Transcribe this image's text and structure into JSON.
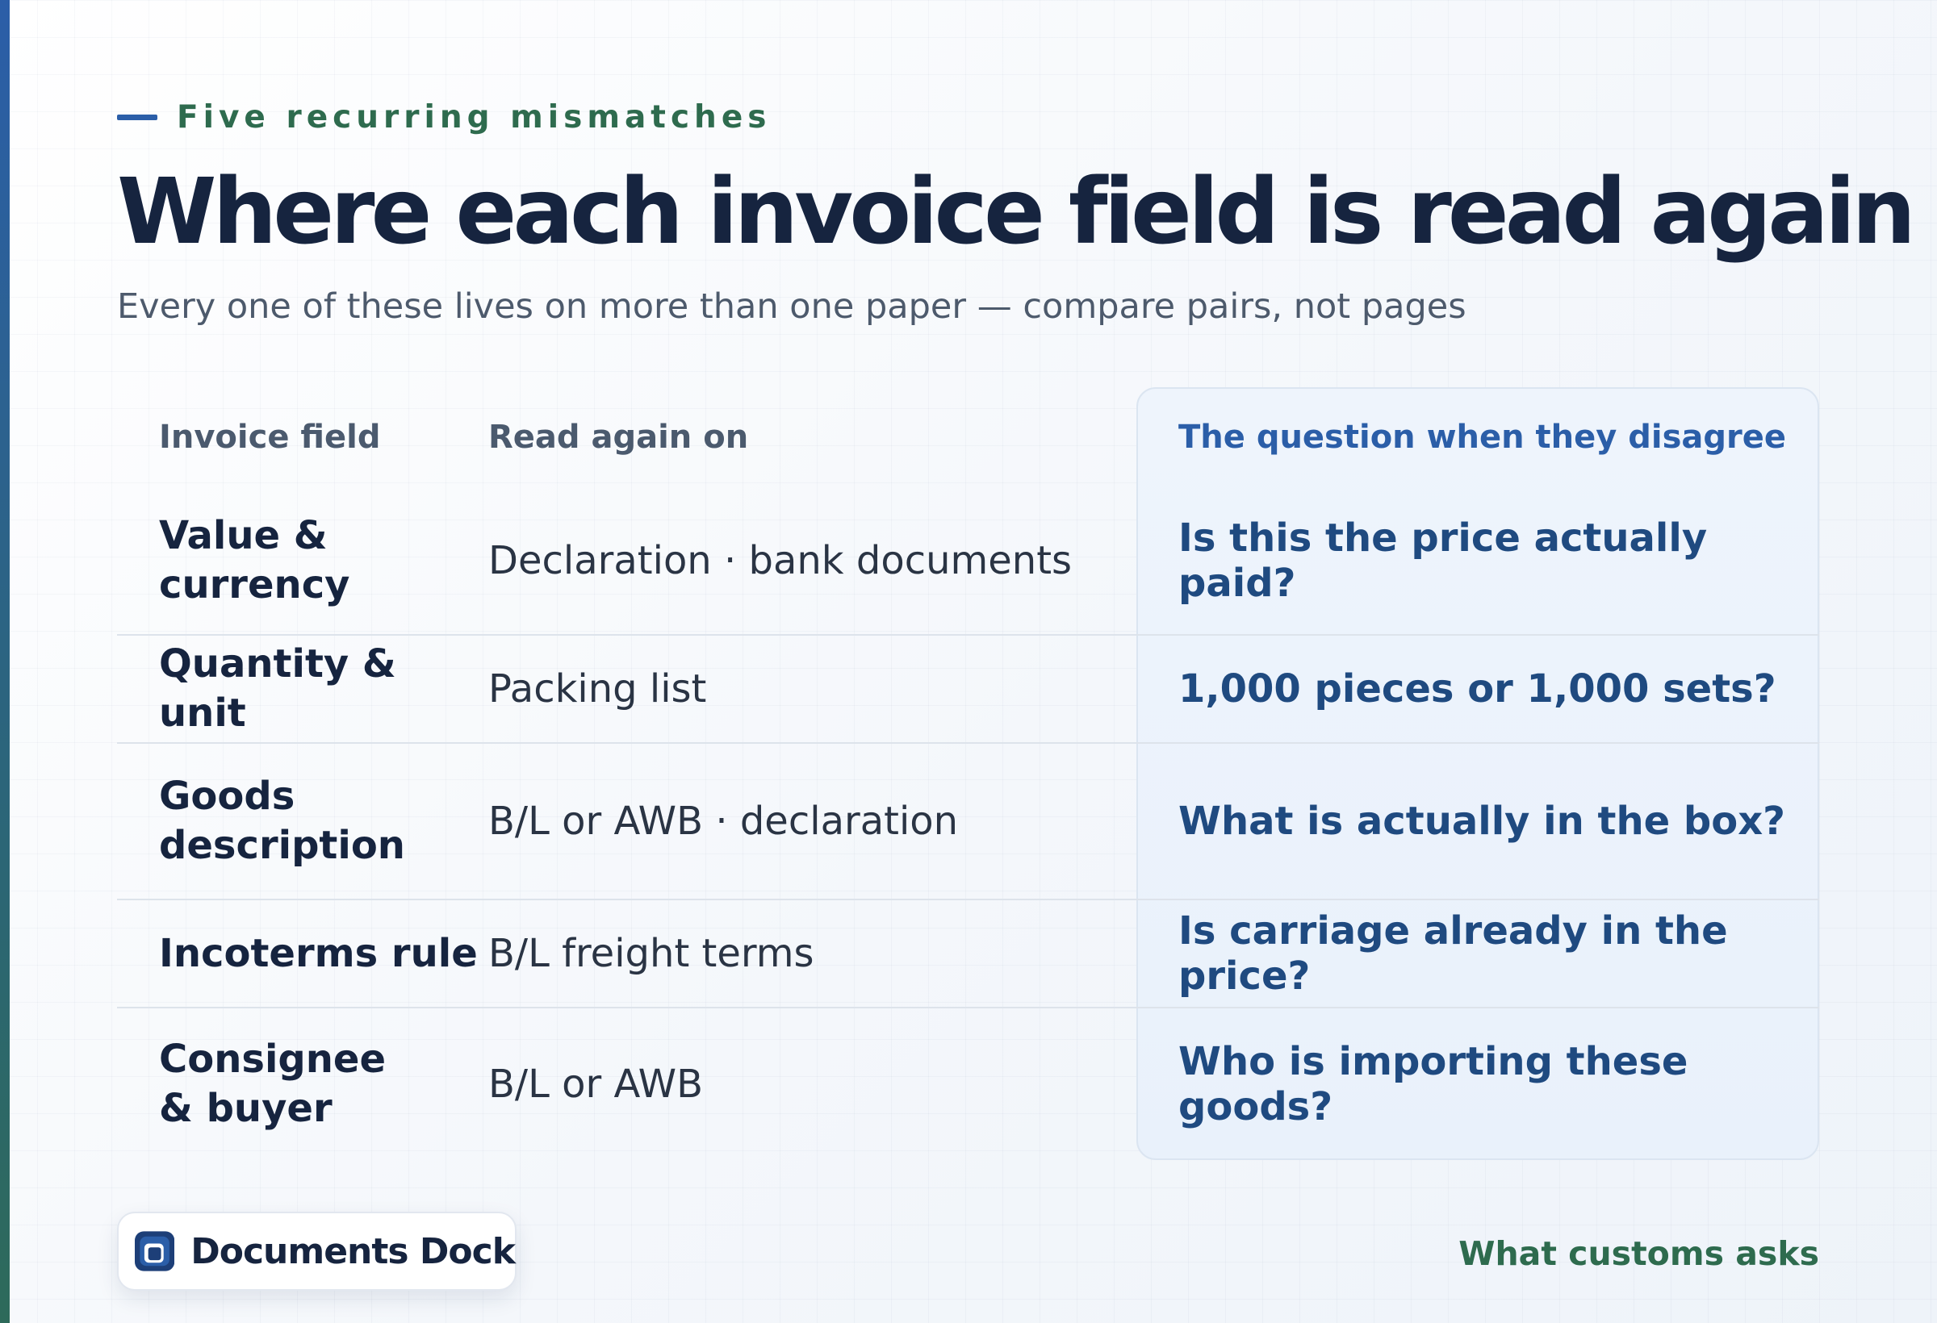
{
  "header": {
    "eyebrow": "Five recurring mismatches",
    "title": "Where each invoice field is read again",
    "subtitle": "Every one of these lives on more than one paper — compare pairs, not pages"
  },
  "table": {
    "columns": [
      "Invoice field",
      "Read again on",
      "The question when they disagree"
    ],
    "rows": [
      {
        "field": "Value & currency",
        "read_again_on": "Declaration · bank documents",
        "question": "Is this the price actually paid?"
      },
      {
        "field": "Quantity & unit",
        "read_again_on": "Packing list",
        "question": "1,000 pieces or 1,000 sets?"
      },
      {
        "field": "Goods description",
        "read_again_on": "B/L or AWB · declaration",
        "question": "What is actually in the box?"
      },
      {
        "field": "Incoterms rule",
        "read_again_on": "B/L freight terms",
        "question": "Is carriage already in the price?"
      },
      {
        "field": "Consignee & buyer",
        "read_again_on": "B/L or AWB",
        "question": "Who is importing these goods?"
      }
    ]
  },
  "footer": {
    "brand": "Documents Dock",
    "label": "What customs asks"
  },
  "colors": {
    "navy": "#16243f",
    "accent_blue": "#2b5ea8",
    "accent_green": "#2e6b4e",
    "question_text": "#1f4a80"
  },
  "icons": {
    "brand_logo": "document-stack-logo-icon"
  }
}
